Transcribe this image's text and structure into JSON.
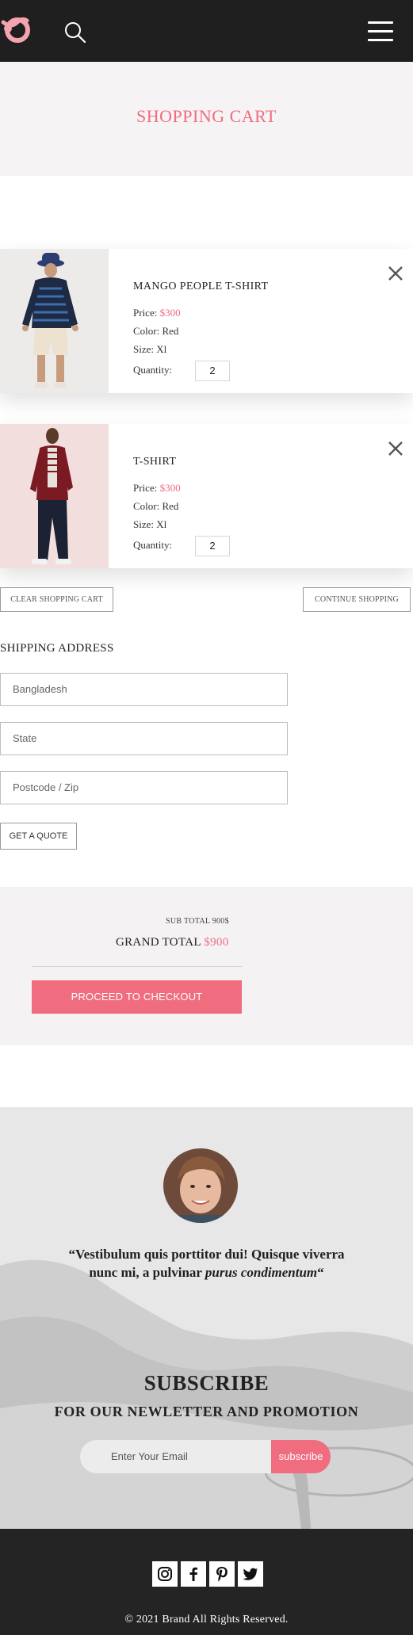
{
  "header": {
    "logo_icon": "brand-logo-icon",
    "search_icon": "search-icon",
    "menu_icon": "hamburger-menu-icon",
    "accent_color": "#f06c7f"
  },
  "banner": {
    "title": "SHOPPING CART"
  },
  "cart": {
    "items": [
      {
        "name": "MANGO PEOPLE T-SHIRT",
        "price_label": "Price:",
        "price": "$300",
        "color_label": "Color:",
        "color": "Red",
        "size_label": "Size:",
        "size": "Xl",
        "quantity_label": "Quantity:",
        "quantity": "2"
      },
      {
        "name": "T-SHIRT",
        "price_label": "Price:",
        "price": "$300",
        "color_label": "Color:",
        "color": "Red",
        "size_label": "Size:",
        "size": "Xl",
        "quantity_label": "Quantity:",
        "quantity": "2"
      }
    ],
    "clear_label": "CLEAR SHOPPING CART",
    "continue_label": "CONTINUE SHOPPING"
  },
  "shipping": {
    "title": "SHIPPING ADDRESS",
    "country_value": "Bangladesh",
    "state_placeholder": "State",
    "zip_placeholder": "Postcode / Zip",
    "quote_label": "GET A QUOTE"
  },
  "totals": {
    "subtotal_text": "SUB TOTAL 900$",
    "grand_label": "GRAND TOTAL",
    "grand_value": "$900",
    "checkout_label": "PROCEED TO CHECKOUT"
  },
  "testimonial": {
    "quote_open": "“Vestibulum quis porttitor dui! Quisque viverra nunc mi, a pulvinar ",
    "quote_em": "purus condimentum",
    "quote_close": "“"
  },
  "subscribe": {
    "title": "SUBSCRIBE",
    "subtitle": "FOR OUR NEWLETTER AND PROMOTION",
    "email_placeholder": "Enter Your Email",
    "button_label": "subscribe"
  },
  "footer": {
    "social_icons": [
      "instagram-icon",
      "facebook-icon",
      "pinterest-icon",
      "twitter-icon"
    ],
    "copyright": "© 2021 Brand All Rights Reserved."
  }
}
